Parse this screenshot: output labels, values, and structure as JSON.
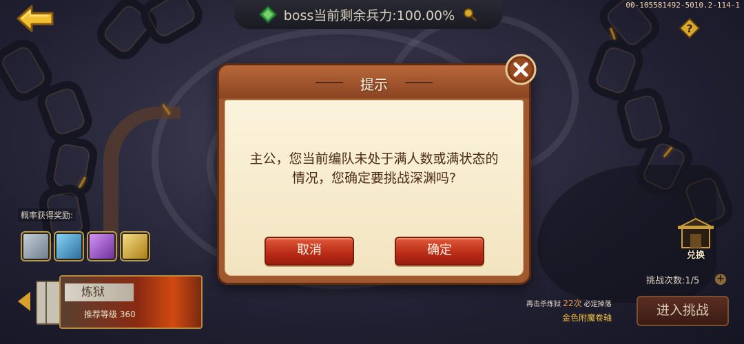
{
  "top_bar": {
    "boss_status": "boss当前剩余兵力:100.00%",
    "version": "00-105581492-5010.2-114-1"
  },
  "rewards": {
    "label": "概率获得奖励:",
    "items": [
      {
        "name": "silver-crystal",
        "color": "#8a9aa8"
      },
      {
        "name": "blue-crystal",
        "color": "#3a8ab8"
      },
      {
        "name": "purple-crystal",
        "color": "#8a3ab8"
      },
      {
        "name": "gold-crystal",
        "color": "#c8a020"
      }
    ]
  },
  "difficulty_card": {
    "name": "炼狱",
    "recommended_level": "推荐等级 360"
  },
  "right_panel": {
    "exchange_label": "兑换",
    "challenge_count": "挑战次数:1/5",
    "add_symbol": "+",
    "kill_hint_prefix": "再击杀炼狱",
    "kill_hint_count": "22次",
    "kill_hint_suffix": "必定掉落",
    "guarantee_item": "金色附魔卷轴",
    "enter_button": "进入挑战"
  },
  "dialog": {
    "title": "提示",
    "message": "主公，您当前编队未处于满人数或满状态的情况，您确定要挑战深渊吗?",
    "cancel_label": "取消",
    "confirm_label": "确定"
  },
  "colors": {
    "dialog_frame": "#a0582e",
    "dialog_body": "#fbf3dc",
    "button_red": "#c0321c",
    "accent_gold": "#d8a02a"
  },
  "icons": {
    "back": "back-arrow-icon",
    "boss": "green-crystal-icon",
    "search": "magnifier-icon",
    "help": "question-icon",
    "close": "close-x-icon",
    "exchange": "shop-icon"
  }
}
